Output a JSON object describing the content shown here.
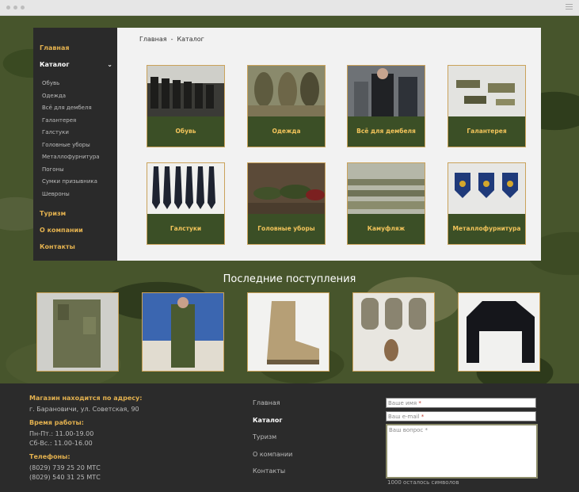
{
  "sidebar": {
    "home": "Главная",
    "catalog": "Каталог",
    "sub": [
      "Обувь",
      "Одежда",
      "Всё для дембеля",
      "Галантерея",
      "Галстуки",
      "Головные уборы",
      "Металлофурнитура",
      "Погоны",
      "Сумки призывника",
      "Шевроны"
    ],
    "tourism": "Туризм",
    "about": "О компании",
    "contacts": "Контакты"
  },
  "breadcrumb": {
    "home": "Главная",
    "sep": "-",
    "current": "Каталог"
  },
  "categories": [
    "Обувь",
    "Одежда",
    "Всё для дембеля",
    "Галантерея",
    "Галстуки",
    "Головные уборы",
    "Камуфляж",
    "Металлофурнитура"
  ],
  "latest": {
    "title": "Последние поступления"
  },
  "footer": {
    "address_title": "Магазин находится по адресу:",
    "address": "г. Барановичи, ул. Советская, 90",
    "hours_title": "Время работы:",
    "hours1": "Пн-Пт.: 11.00-19.00",
    "hours2": "Сб-Вс.: 11.00-16.00",
    "phones_title": "Телефоны:",
    "phone1": "(8029) 739 25 20 МТС",
    "phone2": "(8029) 540 31 25 МТС",
    "nav": [
      "Главная",
      "Каталог",
      "Туризм",
      "О компании",
      "Контакты"
    ],
    "name_placeholder": "Ваше имя",
    "email_placeholder": "Ваш e-mail",
    "question_placeholder": "Ваш вопрос",
    "required_mark": "*",
    "counter": "1000 осталось символов"
  },
  "colors": {
    "accent": "#e3b14f",
    "card_bg": "#3b4f26",
    "sidebar_bg": "#2a2a2a"
  }
}
